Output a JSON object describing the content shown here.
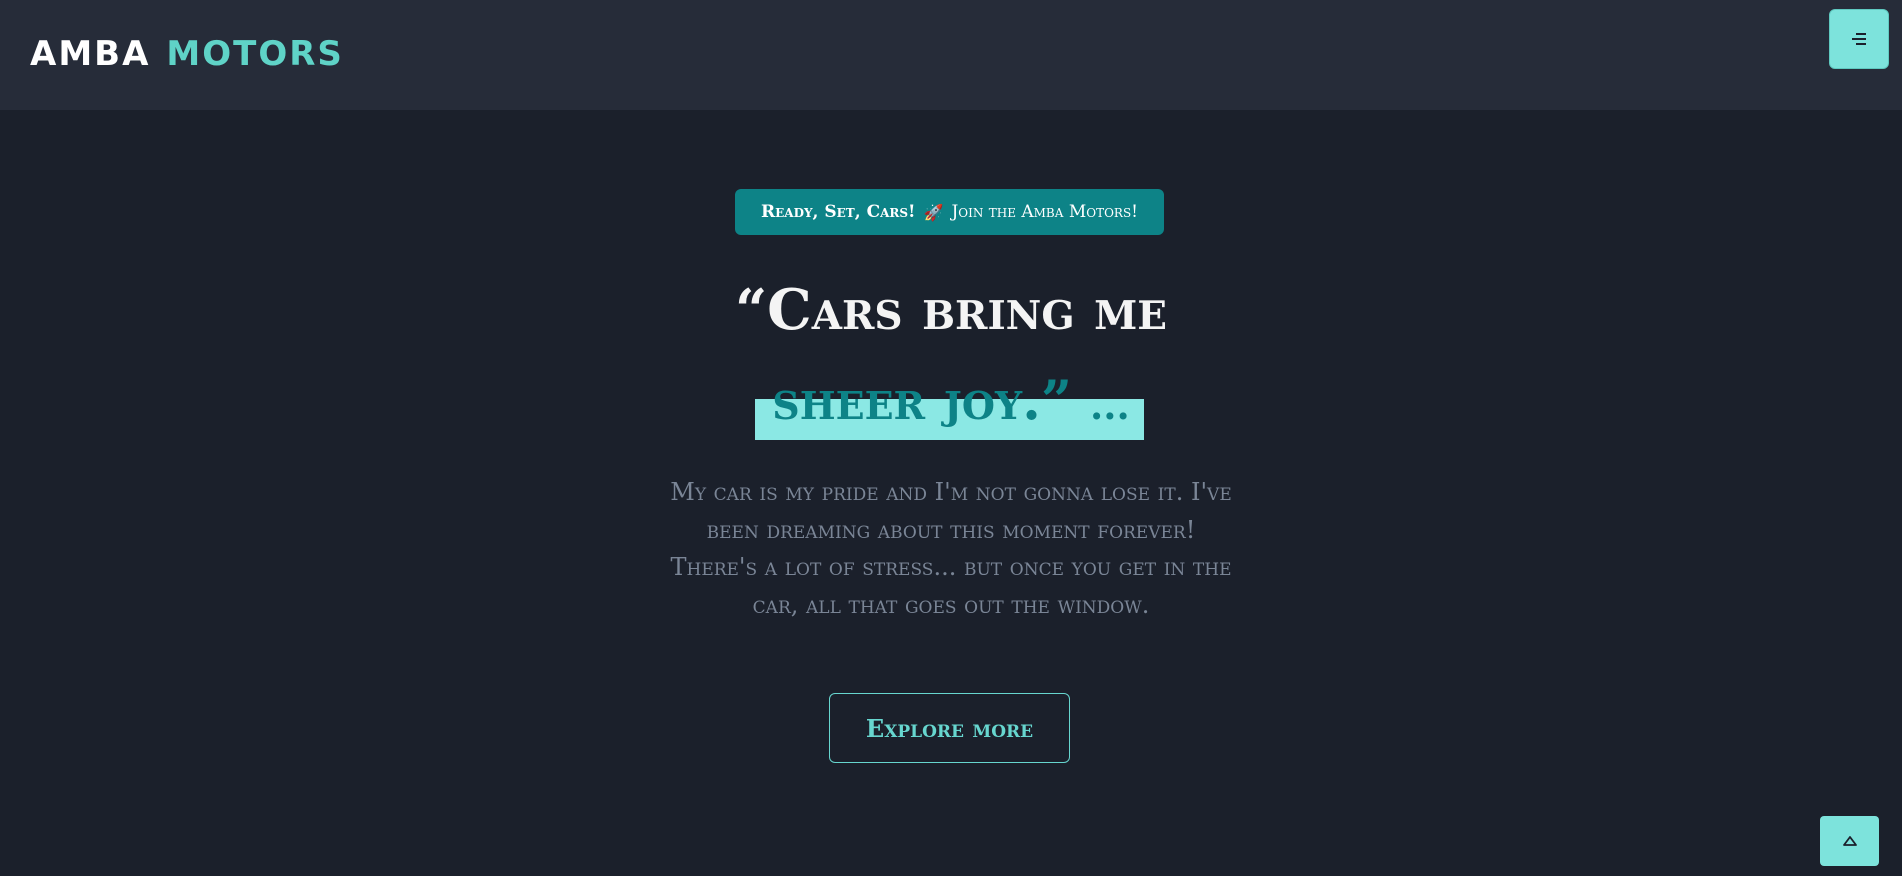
{
  "header": {
    "logo_part1": "AMBA",
    "logo_part2": "MOTORS",
    "menu_icon": "menu-icon"
  },
  "hero": {
    "badge_strong": "Ready, Set, Cars!",
    "badge_icon": "🚀",
    "badge_text": "Join the Amba Motors!",
    "headline_line1": "“Cars bring me",
    "headline_line2": "sheer joy.”",
    "headline_ellipsis": "...",
    "body": "My car is my pride and I'm not gonna lose it. I've been dreaming about this moment forever! There's a lot of stress... but once you get in the car, all that goes out the window.",
    "cta_label": "Explore more"
  },
  "scroll_top": {
    "icon": "chevron-up-icon"
  },
  "colors": {
    "background": "#1b202b",
    "navbar": "#262c39",
    "accent": "#0d8387",
    "accent_light": "#7de3dc",
    "text_muted": "#7a8596"
  }
}
